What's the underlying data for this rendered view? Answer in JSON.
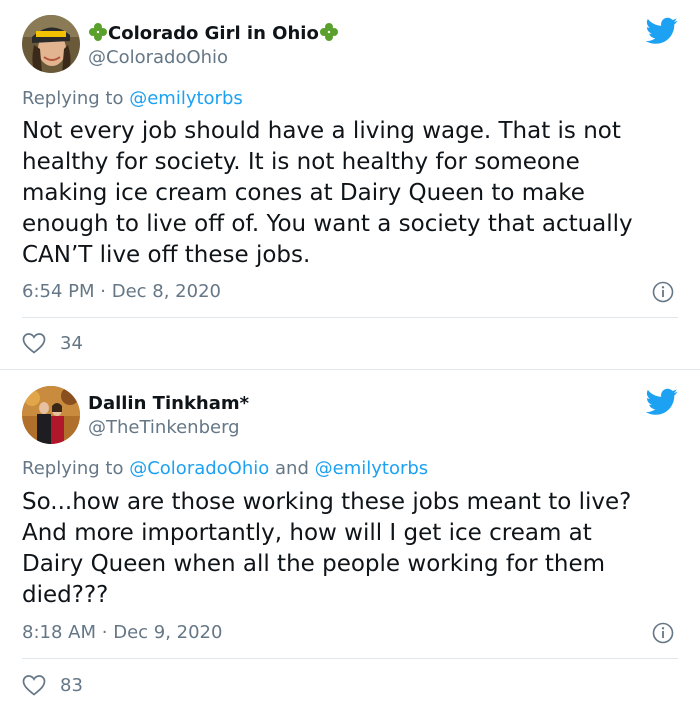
{
  "tweets": [
    {
      "name": "Colorado Girl in Ohio",
      "handle": "@ColoradoOhio",
      "replying_prefix": "Replying to",
      "replying_to": [
        "@emilytorbs"
      ],
      "replying_joiner": "",
      "text_lines": [
        "Not every job should have a living wage. That is not",
        "healthy for society. It is not healthy for someone",
        "making ice cream cones at Dairy Queen to make",
        "enough to live off of.  You want a society that actually",
        "CAN’T live off these jobs."
      ],
      "time": "6:54 PM",
      "date": "Dec 8, 2020",
      "like_count": "34"
    },
    {
      "name": "Dallin Tinkham*",
      "handle": "@TheTinkenberg",
      "replying_prefix": "Replying to",
      "replying_to": [
        "@ColoradoOhio",
        "@emilytorbs"
      ],
      "replying_joiner": "and",
      "text_lines": [
        "So...how are those working these jobs meant to live?",
        "And more importantly, how will I get ice cream at",
        "Dairy Queen when all the people working for them",
        "died???"
      ],
      "time": "8:18 AM",
      "date": "Dec 9, 2020",
      "like_count": "83"
    }
  ],
  "meta_separator": "·",
  "colors": {
    "twitter_blue": "#1da1f2",
    "muted": "#657786",
    "clover_green": "#5aa02c"
  },
  "icons": [
    "twitter-bird-icon",
    "info-icon",
    "heart-icon",
    "clover-icon"
  ]
}
